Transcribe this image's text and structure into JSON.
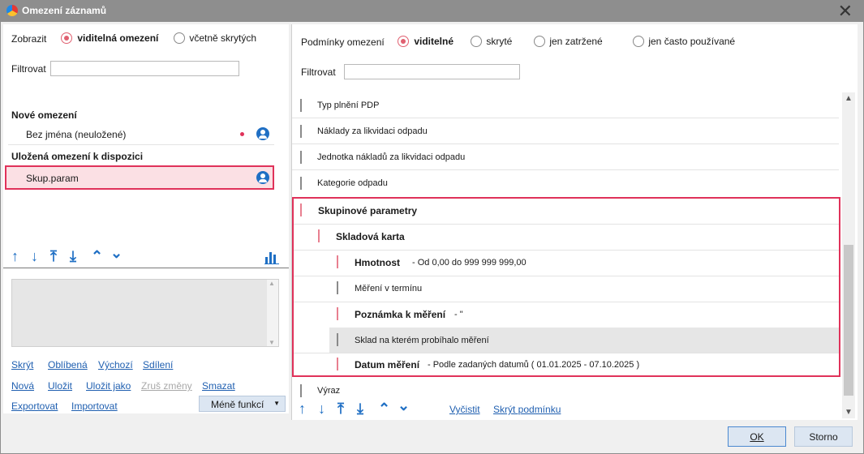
{
  "window": {
    "title": "Omezení záznamů"
  },
  "left": {
    "show_label": "Zobrazit",
    "show_options": [
      "viditelná omezení",
      "včetně skrytých"
    ],
    "filter_label": "Filtrovat",
    "filter_value": "",
    "new_section": "Nové omezení",
    "new_item": "Bez jména (neuložené)",
    "saved_section": "Uložená omezení k dispozici",
    "saved_item": "Skup.param",
    "links_row1": [
      "Skrýt",
      "Oblíbená",
      "Výchozí",
      "Sdílení"
    ],
    "links_row2": [
      "Nová",
      "Uložit",
      "Uložit jako",
      "Zruš změny",
      "Smazat"
    ],
    "links_row3": [
      "Exportovat",
      "Importovat"
    ],
    "less_functions": "Méně funkcí"
  },
  "right": {
    "cond_label": "Podmínky omezení",
    "cond_options": [
      "viditelné",
      "skryté",
      "jen zatržené",
      "jen často používané"
    ],
    "filter_label": "Filtrovat",
    "filter_value": "",
    "items": [
      {
        "label": "Typ plnění PDP",
        "detail": "",
        "checked": false,
        "bold": false
      },
      {
        "label": "Náklady za likvidaci odpadu",
        "detail": "",
        "checked": false,
        "bold": false
      },
      {
        "label": "Jednotka nákladů za likvidaci odpadu",
        "detail": "",
        "checked": false,
        "bold": false
      },
      {
        "label": "Kategorie odpadu",
        "detail": "",
        "checked": false,
        "bold": false
      },
      {
        "label": "Skupinové parametry",
        "detail": "",
        "checked": true,
        "bold": true
      },
      {
        "label": "Skladová karta",
        "detail": "",
        "checked": true,
        "bold": true
      },
      {
        "label": "Hmotnost",
        "detail": "- Od 0,00 do 999 999 999,00",
        "checked": true,
        "bold": true
      },
      {
        "label": "Měření v termínu",
        "detail": "",
        "checked": false,
        "bold": false
      },
      {
        "label": "Poznámka k měření",
        "detail": "- \"",
        "checked": true,
        "bold": true
      },
      {
        "label": "Sklad na kterém probíhalo měření",
        "detail": "",
        "checked": false,
        "bold": false
      },
      {
        "label": "Datum měření",
        "detail": "- Podle zadaných datumů ( 01.01.2025 - 07.10.2025 )",
        "checked": true,
        "bold": true
      },
      {
        "label": "Výraz",
        "detail": "",
        "checked": false,
        "bold": false
      }
    ],
    "clear_link": "Vyčistit",
    "hide_condition_link": "Skrýt podmínku"
  },
  "footer": {
    "ok": "OK",
    "cancel": "Storno"
  },
  "colors": {
    "accent": "#e0325a",
    "link": "#1f5fb0",
    "checkbox": "#e88090"
  }
}
